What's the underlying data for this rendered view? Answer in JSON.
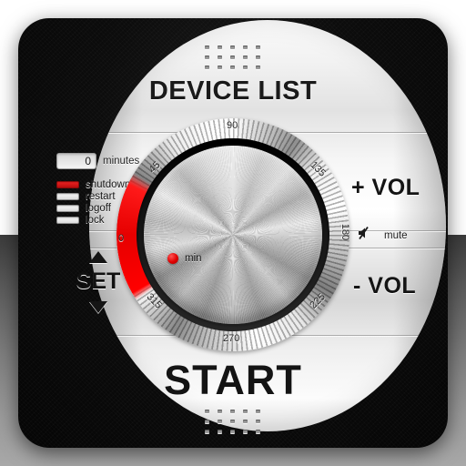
{
  "app": {
    "title": "DEVICE LIST",
    "start_label": "START"
  },
  "timer": {
    "minutes_value": "0",
    "minutes_placeholder": "0",
    "minutes_label": "minutes",
    "actions": [
      {
        "label": "shutdown",
        "selected": true
      },
      {
        "label": "restart",
        "selected": false
      },
      {
        "label": "logoff",
        "selected": false
      },
      {
        "label": "lock",
        "selected": false
      }
    ]
  },
  "set": {
    "label": "SET",
    "up_icon": "triangle-up-icon",
    "down_icon": "triangle-down-icon"
  },
  "volume": {
    "increase_label": "+ VOL",
    "decrease_label": "- VOL",
    "mute_label": "mute",
    "mute_icon": "speaker-mute-icon"
  },
  "dial": {
    "min_label": "min",
    "min_indicator_icon": "red-dot-icon",
    "tick_labels": [
      "0",
      "45",
      "90",
      "135",
      "180",
      "225",
      "270",
      "315"
    ],
    "ticks": {
      "t0": "0",
      "t45": "45",
      "t90": "90",
      "t135": "135",
      "t180": "180",
      "t225": "225",
      "t270": "270",
      "t315": "315"
    },
    "arc_color": "#ff0000"
  },
  "grille": {
    "top_icon": "speaker-grille-icon",
    "bottom_icon": "speaker-grille-icon"
  },
  "colors": {
    "accent": "#e00000",
    "panel": "#0a0a0a",
    "disc": "#f2f2f2",
    "text": "#151515"
  }
}
